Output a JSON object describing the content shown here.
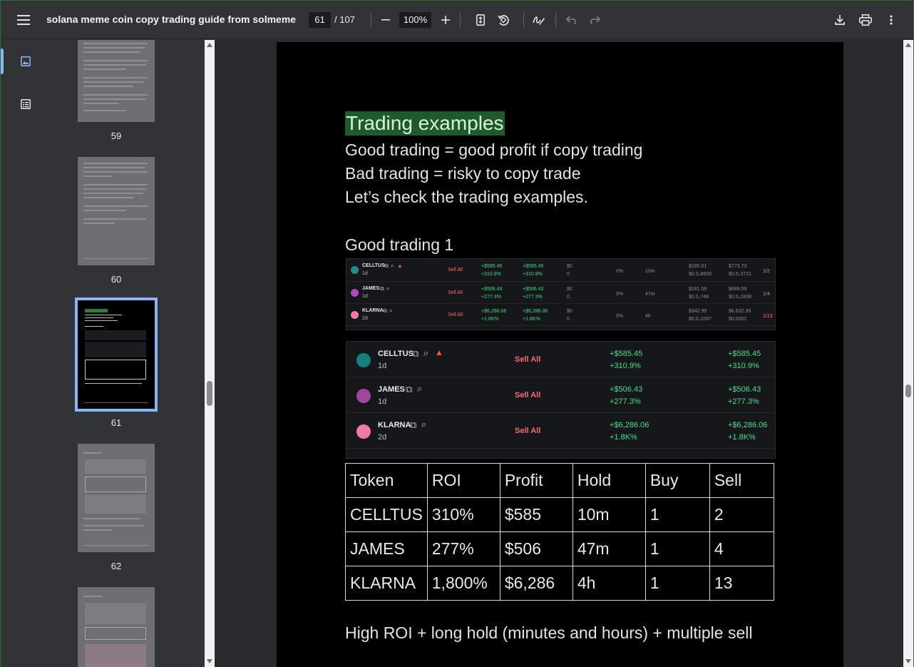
{
  "toolbar": {
    "title": "solana meme coin copy trading guide from solmeme",
    "current_page": "61",
    "total_pages": "/ 107",
    "zoom": "100%"
  },
  "thumbnails": [
    {
      "label": "59"
    },
    {
      "label": "60"
    },
    {
      "label": "61"
    },
    {
      "label": "62"
    }
  ],
  "page": {
    "heading": "Trading examples",
    "lines": [
      "Good trading = good profit if copy trading",
      "Bad trading = risky to copy trade",
      "Let’s check the trading examples."
    ],
    "subheading": "Good trading 1",
    "screenshot_small": {
      "sell_label": "Sell All",
      "rows": [
        {
          "token": "CELLTUS",
          "age": "1d",
          "pnl1": "+$585.45",
          "pct1": "+310.9%",
          "pnl2": "+$585.45",
          "pct2": "+310.9%",
          "zero1": "$0",
          "zero2": "0",
          "pct0": "0%",
          "hold": "10m",
          "val1": "$180.01",
          "val1b": "$0.0₄8658",
          "val2": "$773.73",
          "val2b": "$0.0₃3721",
          "bs": "1/2",
          "buy": "1",
          "sell": "2"
        },
        {
          "token": "JAMES",
          "age": "1d",
          "pnl1": "+$506.43",
          "pct1": "+277.3%",
          "pnl2": "+$506.43",
          "pct2": "+277.3%",
          "zero1": "$0",
          "zero2": "0",
          "pct0": "0%",
          "hold": "47m",
          "val1": "$181.59",
          "val1b": "$0.0₃748",
          "val2": "$689.09",
          "val2b": "$0.0₃2838",
          "bs": "1/4",
          "buy": "1",
          "sell": "4"
        },
        {
          "token": "KLARNA",
          "age": "2d",
          "pnl1": "+$6,286.06",
          "pct1": "+1.8K%",
          "pnl2": "+$6,286.06",
          "pct2": "+1.8K%",
          "zero1": "$0",
          "zero2": "0",
          "pct0": "0%",
          "hold": "4h",
          "val1": "$342.99",
          "val1b": "$0.0₄1067",
          "val2": "$6,632.39",
          "val2b": "$0.0002",
          "bs": "1/13",
          "buy": "1",
          "sell": "13"
        }
      ]
    },
    "screenshot_zoom": {
      "sell_label": "Sell All",
      "rows": [
        {
          "token": "CELLTUS",
          "age": "1d",
          "pnl": "+$585.45",
          "pct": "+310.9%"
        },
        {
          "token": "JAMES",
          "age": "1d",
          "pnl": "+$506.43",
          "pct": "+277.3%"
        },
        {
          "token": "KLARNA",
          "age": "2d",
          "pnl": "+$6,286.06",
          "pct": "+1.8K%"
        }
      ]
    },
    "table": {
      "headers": [
        "Token",
        "ROI",
        "Profit",
        "Hold",
        "Buy",
        "Sell"
      ],
      "rows": [
        [
          "CELLTUS",
          "310%",
          "$585",
          "10m",
          "1",
          "2"
        ],
        [
          "JAMES",
          "277%",
          "$506",
          "47m",
          "1",
          "4"
        ],
        [
          "KLARNA",
          "1,800%",
          "$6,286",
          "4h",
          "1",
          "13"
        ]
      ]
    },
    "footer": "High ROI + long hold (minutes and hours) + multiple sell"
  },
  "colors": {
    "accent": "#8ab4f8",
    "highlight": "#1f5a2b",
    "profit": "#3fdc82",
    "sell": "#ff6b6b"
  }
}
